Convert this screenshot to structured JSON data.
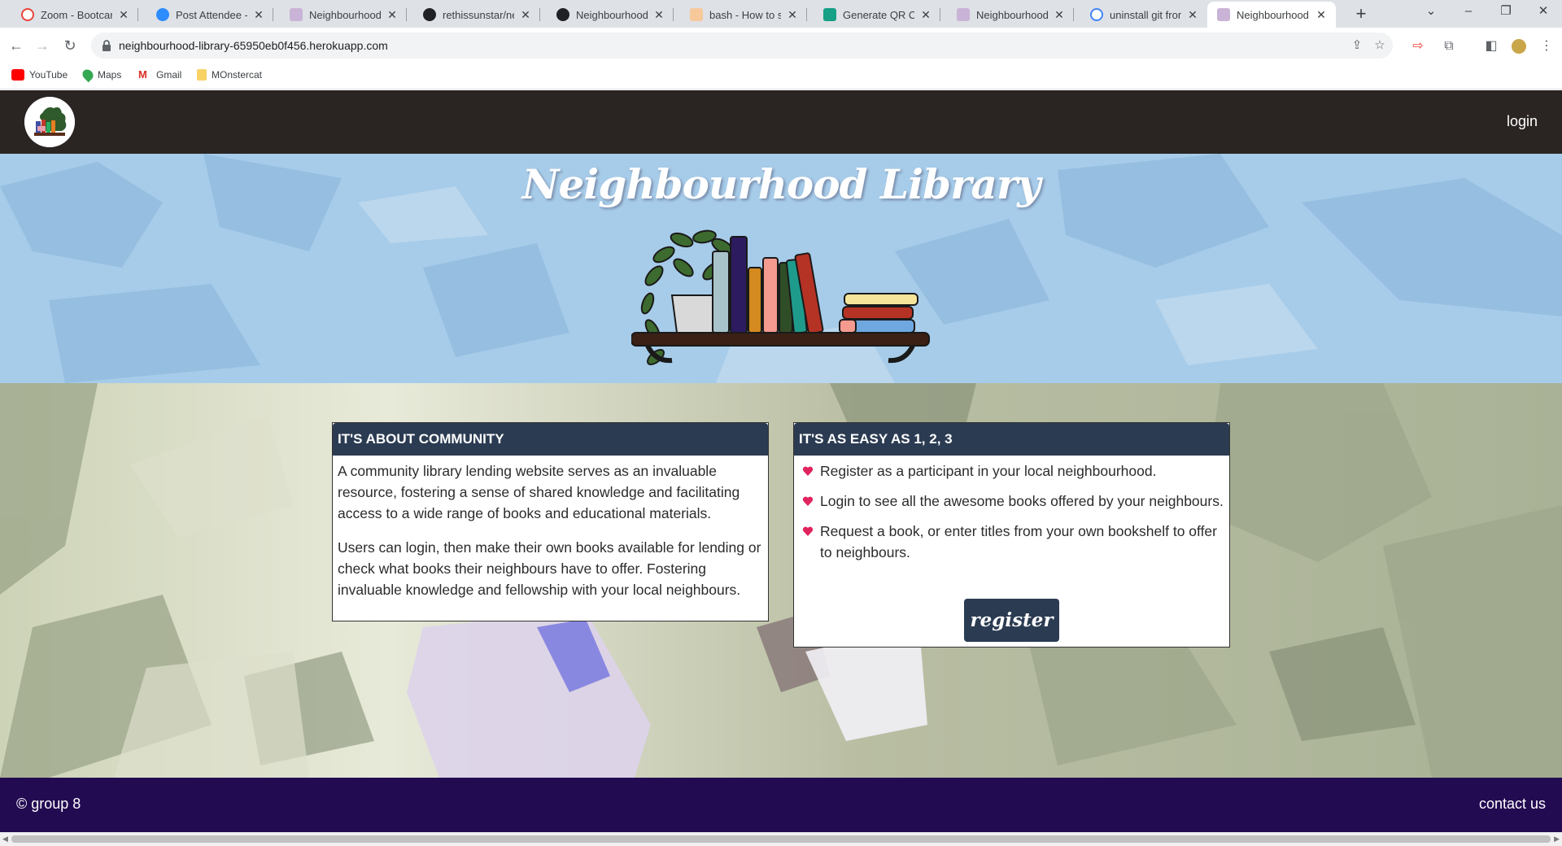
{
  "browser": {
    "tabs": [
      {
        "title": "Zoom - Bootcamp",
        "active": false,
        "favicon_color": "#e8463a"
      },
      {
        "title": "Post Attendee - Zoom",
        "active": false,
        "favicon_color": "#2d8cff"
      },
      {
        "title": "Neighbourhood Library",
        "active": false,
        "favicon_color": "#8a5a9e"
      },
      {
        "title": "rethissunstar/neighbourhood",
        "active": false,
        "favicon_color": "#202124"
      },
      {
        "title": "NeighbourhoodLibrary",
        "active": false,
        "favicon_color": "#202124"
      },
      {
        "title": "bash - How to set",
        "active": false,
        "favicon_color": "#f48024"
      },
      {
        "title": "Generate QR Code",
        "active": false,
        "favicon_color": "#16a085"
      },
      {
        "title": "Neighbourhood Library",
        "active": false,
        "favicon_color": "#8a5a9e"
      },
      {
        "title": "uninstall git from",
        "active": false,
        "favicon_color": "#4285f4"
      },
      {
        "title": "Neighbourhood Library",
        "active": true,
        "favicon_color": "#8a5a9e"
      }
    ],
    "url": "neighbourhood-library-65950eb0f456.herokuapp.com",
    "bookmarks": [
      {
        "label": "YouTube",
        "icon": "youtube-icon"
      },
      {
        "label": "Maps",
        "icon": "maps-icon"
      },
      {
        "label": "Gmail",
        "icon": "gmail-icon"
      },
      {
        "label": "MOnstercat",
        "icon": "folder-icon"
      }
    ]
  },
  "header": {
    "login_label": "login"
  },
  "hero": {
    "title": "Neighbourhood Library"
  },
  "about_card": {
    "title": "IT'S ABOUT COMMUNITY",
    "paragraphs": [
      "A community library lending website serves as an invaluable resource, fostering a sense of shared knowledge and facilitating access to a wide range of books and educational materials.",
      "Users can login, then make their own books available for lending or check what books their neighbours have to offer. Fostering invaluable knowledge and fellowship with your local neighbours."
    ]
  },
  "steps_card": {
    "title": "IT'S AS EASY AS 1, 2, 3",
    "steps": [
      "Register as a participant in your local neighbourhood.",
      "Login to see all the awesome books offered by your neighbours.",
      "Request a book, or enter titles from your own bookshelf to offer to neighbours."
    ],
    "register_label": "register"
  },
  "footer": {
    "copyright": "© group 8",
    "contact_label": "contact us"
  },
  "colors": {
    "header_bg": "#2a2523",
    "hero_bg": "#a7cce9",
    "card_header_bg": "#2b3b52",
    "footer_bg": "#230b52",
    "heart": "#e0245e"
  }
}
